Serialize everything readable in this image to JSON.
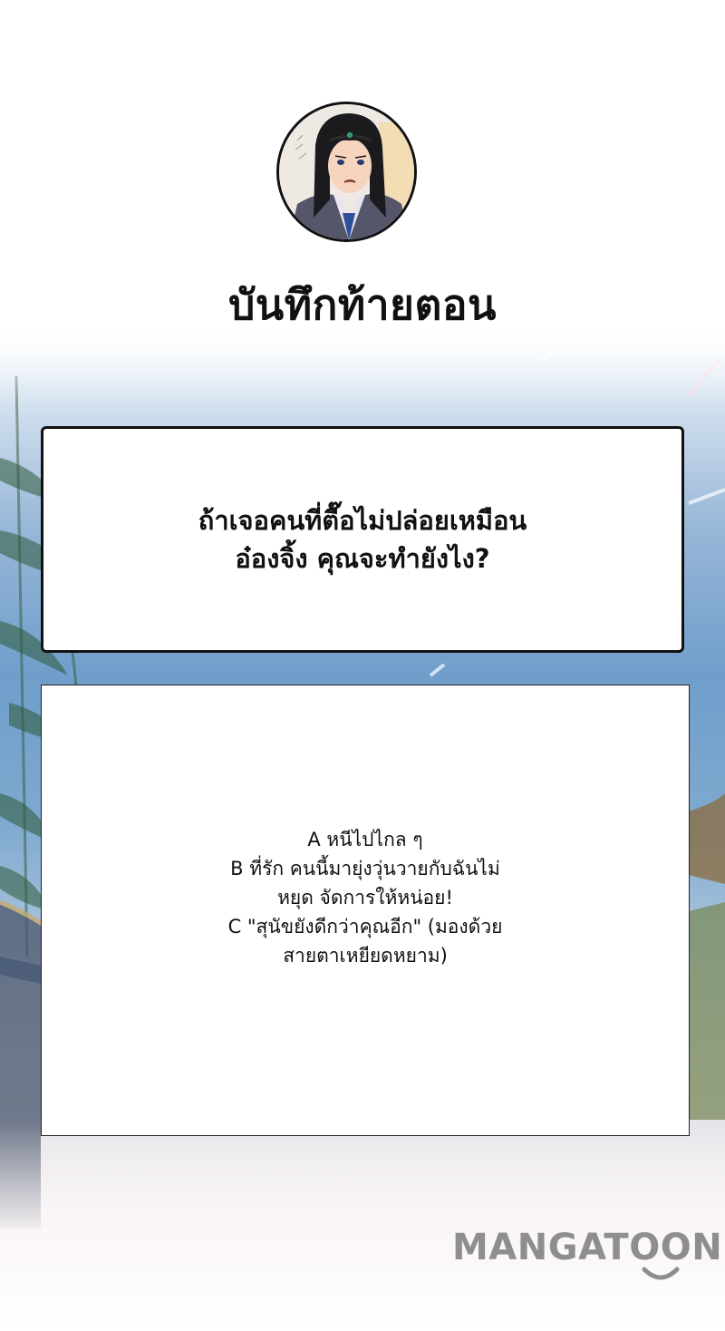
{
  "title": "บันทึกท้ายตอน",
  "question": {
    "line1": "ถ้าเจอคนที่ตื๊อไม่ปล่อยเหมือน",
    "line2": "อ๋องจิ้ง คุณจะทำยังไง?"
  },
  "answers": [
    "A หนีไปไกล ๆ",
    "B ที่รัก คนนี้มายุ่งวุ่นวายกับฉันไม่",
    "หยุด จัดการให้หน่อย!",
    "C \"สุนัขยังดีกว่าคุณอีก\" (มองด้วย",
    "สายตาเหยียดหยาม)"
  ],
  "brand": {
    "name": "MANGATOON",
    "color": "#8e8e8e"
  },
  "colors": {
    "text": "#111111",
    "box_border": "#111111",
    "sky": "#6f9ecb"
  },
  "icons": {
    "avatar": "character-portrait",
    "brand_mark": "smile-icon"
  }
}
